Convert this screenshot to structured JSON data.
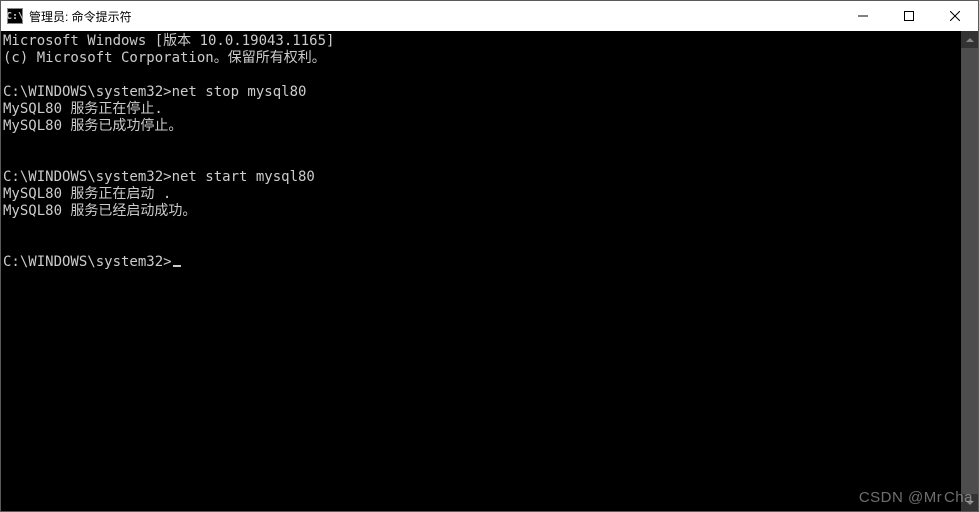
{
  "titlebar": {
    "icon_label": "C:\\",
    "title": "管理员: 命令提示符"
  },
  "terminal": {
    "lines": [
      "Microsoft Windows [版本 10.0.19043.1165]",
      "(c) Microsoft Corporation。保留所有权利。",
      "",
      "C:\\WINDOWS\\system32>net stop mysql80",
      "MySQL80 服务正在停止.",
      "MySQL80 服务已成功停止。",
      "",
      "",
      "C:\\WINDOWS\\system32>net start mysql80",
      "MySQL80 服务正在启动 .",
      "MySQL80 服务已经启动成功。",
      "",
      "",
      "C:\\WINDOWS\\system32>"
    ]
  },
  "watermark": "CSDN @Mr Cha"
}
